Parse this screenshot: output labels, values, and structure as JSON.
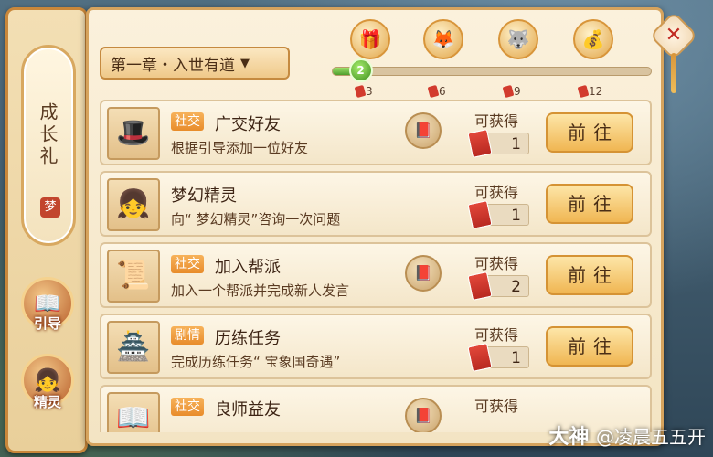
{
  "left_panel": {
    "growth_tab": "成长礼",
    "growth_seal": "梦",
    "guide_label": "引导",
    "spirit_label": "精灵"
  },
  "chapter": {
    "label": "第一章・入世有道"
  },
  "progress": {
    "current": "2",
    "fraction": 0.09,
    "milestones": [
      {
        "icon": "gift-bag-icon",
        "count": "3"
      },
      {
        "icon": "fox-mascot-icon",
        "count": "6"
      },
      {
        "icon": "fox-spirit-icon",
        "count": "9"
      },
      {
        "icon": "treasure-bag-icon",
        "count": "12"
      }
    ]
  },
  "close_label": "✕",
  "reward_label": "可获得",
  "go_label": "前往",
  "tasks": [
    {
      "tag": "社交",
      "title": "广交好友",
      "desc": "根据引导添加一位好友",
      "reward": "1",
      "avatar": "🎩",
      "has_book": true
    },
    {
      "tag": "",
      "title": "梦幻精灵",
      "desc": "向“ 梦幻精灵”咨询一次问题",
      "reward": "1",
      "avatar": "👧",
      "has_book": false
    },
    {
      "tag": "社交",
      "title": "加入帮派",
      "desc": "加入一个帮派并完成新人发言",
      "reward": "2",
      "avatar": "📜",
      "has_book": true
    },
    {
      "tag": "剧情",
      "title": "历练任务",
      "desc": "完成历练任务“ 宝象国奇遇”",
      "reward": "1",
      "avatar": "🏯",
      "has_book": false
    },
    {
      "tag": "社交",
      "title": "良师益友",
      "desc": "",
      "reward": "",
      "avatar": "📖",
      "has_book": true
    }
  ],
  "watermark": {
    "brand": "大神",
    "user": "@凌晨五五开"
  }
}
